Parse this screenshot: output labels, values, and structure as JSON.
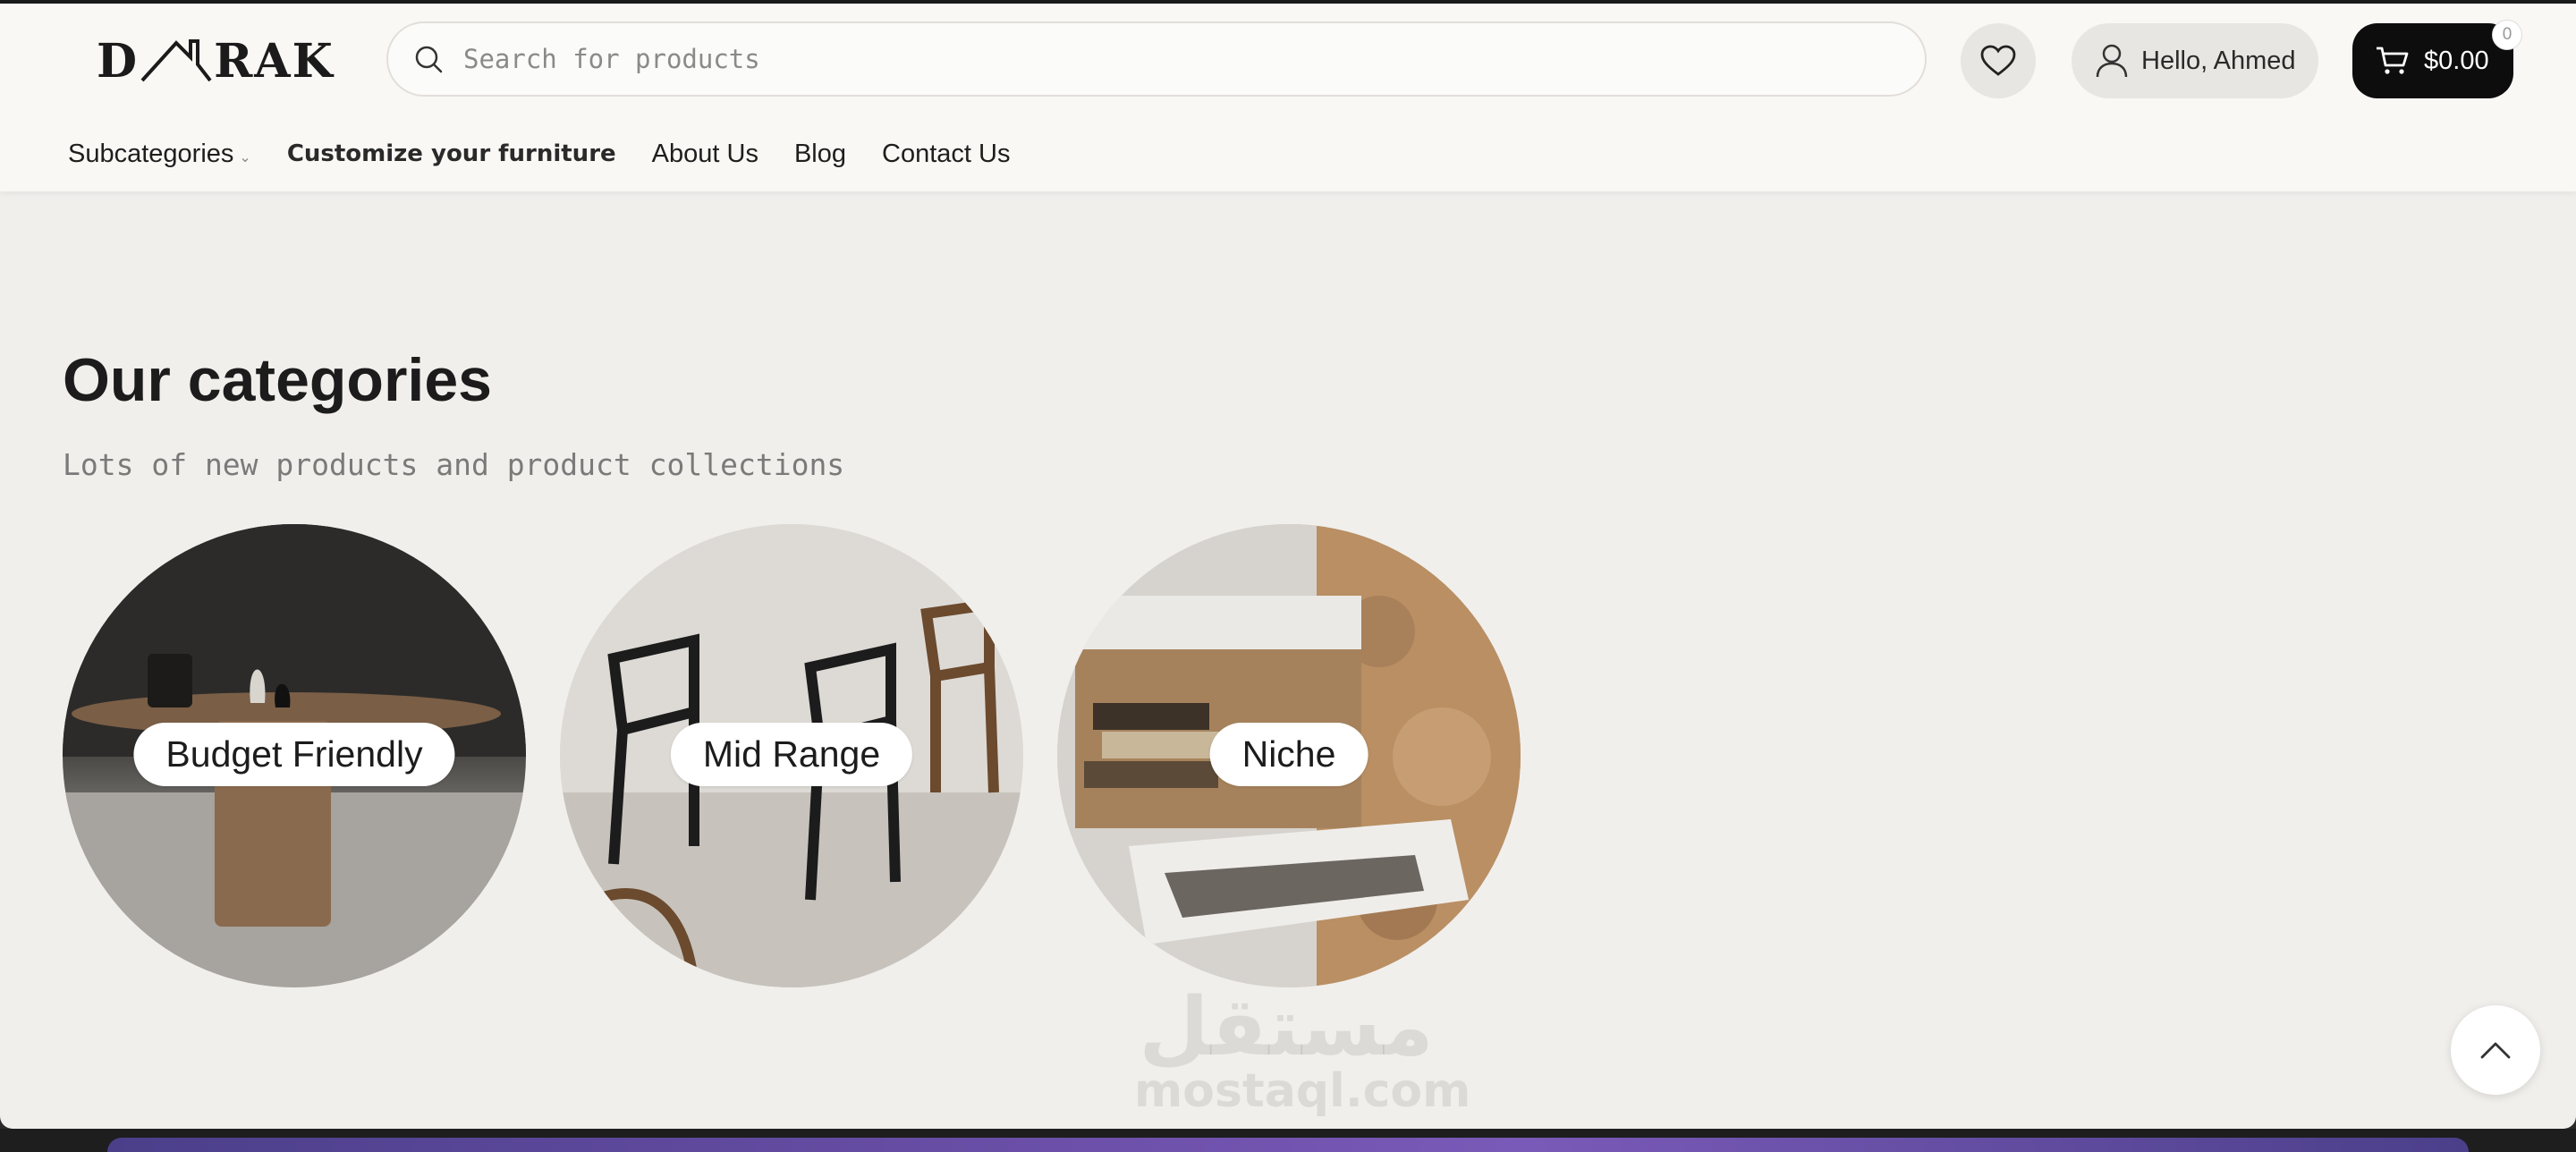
{
  "brand": {
    "logo_text_left": "D",
    "logo_text_right": "RAK"
  },
  "search": {
    "placeholder": "Search for products"
  },
  "header": {
    "account_label": "Hello, Ahmed",
    "cart_amount": "$0.00",
    "cart_count": "0"
  },
  "nav": {
    "items": [
      {
        "label": "Subcategories"
      },
      {
        "label": "Customize your furniture"
      },
      {
        "label": "About Us"
      },
      {
        "label": "Blog"
      },
      {
        "label": "Contact Us"
      }
    ]
  },
  "main": {
    "title": "Our categories",
    "subtitle": "Lots of new products and product collections",
    "categories": [
      {
        "label": "Budget Friendly"
      },
      {
        "label": "Mid Range"
      },
      {
        "label": "Niche"
      }
    ]
  },
  "watermark": {
    "arabic": "مستقل",
    "latin": "mostaql.com"
  },
  "colors": {
    "accent": "#0d0d0d",
    "page_bg": "#f1efec",
    "header_bg": "#f9f8f5"
  }
}
